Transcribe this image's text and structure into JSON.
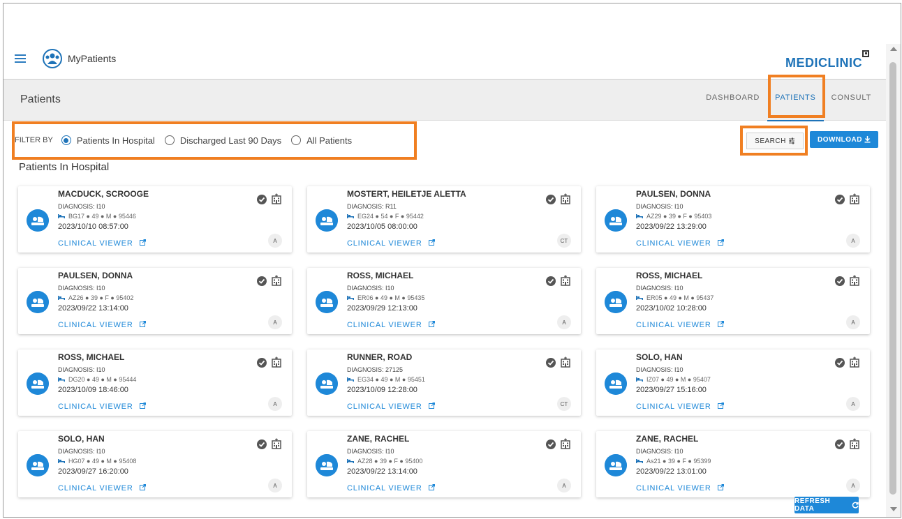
{
  "app": {
    "title": "MyPatients",
    "brand": "MEDICLINIC"
  },
  "subheader": {
    "page_title": "Patients",
    "tabs": [
      {
        "label": "DASHBOARD",
        "active": false
      },
      {
        "label": "PATIENTS",
        "active": true
      },
      {
        "label": "CONSULT",
        "active": false
      }
    ]
  },
  "filter": {
    "label": "FILTER BY",
    "options": [
      {
        "label": "Patients In Hospital",
        "checked": true
      },
      {
        "label": "Discharged Last 90 Days",
        "checked": false
      },
      {
        "label": "All Patients",
        "checked": false
      }
    ]
  },
  "toolbar": {
    "search_label": "SEARCH",
    "download_label": "DOWNLOAD",
    "refresh_label": "REFRESH DATA"
  },
  "section_title": "Patients In Hospital",
  "cards": [
    {
      "name": "MACDUCK, SCROOGE",
      "diagnosis": "DIAGNOSIS: I10",
      "info": "BG17 ● 49 ● M ● 95446",
      "datetime": "2023/10/10 08:57:00",
      "link": "CLINICAL VIEWER",
      "badge": "A"
    },
    {
      "name": "MOSTERT, HEILETJE ALETTA",
      "diagnosis": "DIAGNOSIS: R11",
      "info": "EG24 ● 54 ● F ● 95442",
      "datetime": "2023/10/05 08:00:00",
      "link": "CLINICAL VIEWER",
      "badge": "CT"
    },
    {
      "name": "PAULSEN, DONNA",
      "diagnosis": "DIAGNOSIS: I10",
      "info": "AZ29 ● 39 ● F ● 95403",
      "datetime": "2023/09/22 13:29:00",
      "link": "CLINICAL VIEWER",
      "badge": "A"
    },
    {
      "name": "PAULSEN, DONNA",
      "diagnosis": "DIAGNOSIS: I10",
      "info": "AZ26 ● 39 ● F ● 95402",
      "datetime": "2023/09/22 13:14:00",
      "link": "CLINICAL VIEWER",
      "badge": "A"
    },
    {
      "name": "ROSS, MICHAEL",
      "diagnosis": "DIAGNOSIS: I10",
      "info": "ER06 ● 49 ● M ● 95435",
      "datetime": "2023/09/29 12:13:00",
      "link": "CLINICAL VIEWER",
      "badge": "A"
    },
    {
      "name": "ROSS, MICHAEL",
      "diagnosis": "DIAGNOSIS: I10",
      "info": "ER05 ● 49 ● M ● 95437",
      "datetime": "2023/10/02 10:28:00",
      "link": "CLINICAL VIEWER",
      "badge": "A"
    },
    {
      "name": "ROSS, MICHAEL",
      "diagnosis": "DIAGNOSIS: I10",
      "info": "DG20 ● 49 ● M ● 95444",
      "datetime": "2023/10/09 18:46:00",
      "link": "CLINICAL VIEWER",
      "badge": "A"
    },
    {
      "name": "RUNNER, ROAD",
      "diagnosis": "DIAGNOSIS: 27125",
      "info": "EG34 ● 49 ● M ● 95451",
      "datetime": "2023/10/09 12:28:00",
      "link": "CLINICAL VIEWER",
      "badge": "CT"
    },
    {
      "name": "SOLO, HAN",
      "diagnosis": "DIAGNOSIS: I10",
      "info": "IZ07 ● 49 ● M ● 95407",
      "datetime": "2023/09/27 15:16:00",
      "link": "CLINICAL VIEWER",
      "badge": "A"
    },
    {
      "name": "SOLO, HAN",
      "diagnosis": "DIAGNOSIS: I10",
      "info": "HG07 ● 49 ● M ● 95408",
      "datetime": "2023/09/27 16:20:00",
      "link": "CLINICAL VIEWER",
      "badge": "A"
    },
    {
      "name": "ZANE, RACHEL",
      "diagnosis": "DIAGNOSIS: I10",
      "info": "AZ28 ● 39 ● F ● 95400",
      "datetime": "2023/09/22 13:14:00",
      "link": "CLINICAL VIEWER",
      "badge": "A"
    },
    {
      "name": "ZANE, RACHEL",
      "diagnosis": "DIAGNOSIS: I10",
      "info": "As21 ● 39 ● F ● 95399",
      "datetime": "2023/09/22 13:01:00",
      "link": "CLINICAL VIEWER",
      "badge": "A"
    }
  ],
  "colors": {
    "accent": "#1e88d8",
    "brand": "#1e73b8",
    "highlight": "#f07f22"
  },
  "icons": {
    "menu": "hamburger-menu-icon",
    "logo": "mypatients-logo-icon",
    "check": "check-circle-icon",
    "hospital": "hospital-icon",
    "external": "external-link-icon",
    "bed": "bed-icon",
    "patient": "patient-avatar-icon",
    "filter": "filter-icon",
    "download": "download-icon",
    "refresh": "refresh-icon"
  }
}
